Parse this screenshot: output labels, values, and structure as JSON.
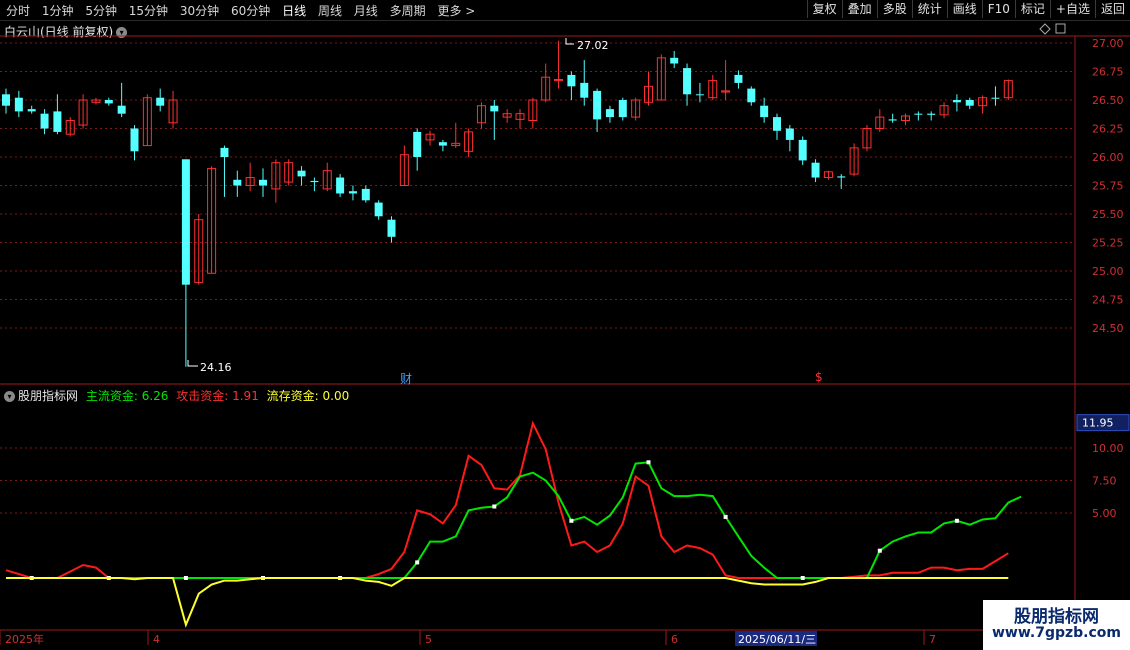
{
  "toolbar": {
    "periods": [
      "分时",
      "1分钟",
      "5分钟",
      "15分钟",
      "30分钟",
      "60分钟",
      "日线",
      "周线",
      "月线",
      "多周期",
      "更多 >"
    ],
    "active_period": "日线",
    "tools": [
      "复权",
      "叠加",
      "多股",
      "统计",
      "画线",
      "F10",
      "标记",
      "+自选",
      "返回"
    ]
  },
  "stock": {
    "title": "白云山(日线 前复权)",
    "high_label": "27.02",
    "low_label": "24.16",
    "marker_fin": "财",
    "marker_dollar": "$"
  },
  "price_axis": [
    "27.00",
    "26.75",
    "26.50",
    "26.25",
    "26.00",
    "25.75",
    "25.50",
    "25.25",
    "25.00",
    "24.75",
    "24.50"
  ],
  "indicator": {
    "name": "股朋指标网",
    "line1": "主流资金: 6.26",
    "line2": "攻击资金: 1.91",
    "line3": "流存资金: 0.00",
    "axis": [
      "11.95",
      "10.00",
      "7.50",
      "5.00"
    ],
    "current_value": "11.95"
  },
  "date_axis": {
    "labels": [
      "2025年",
      "4",
      "5",
      "6",
      "7"
    ],
    "cursor_date": "2025/06/11/三"
  },
  "colors": {
    "up": "#ff3030",
    "down": "#54ffff",
    "main_line": "#00e600",
    "attack_line": "#ff1a1a",
    "stock_line": "#ffff30",
    "grid": "#7a1a1a",
    "axis_text": "#d03030"
  },
  "chart_data": {
    "type": "candlestick",
    "price_ylim": [
      24.16,
      27.02
    ],
    "candles": [
      {
        "o": 26.45,
        "c": 26.55,
        "h": 26.6,
        "l": 26.38,
        "up": false
      },
      {
        "o": 26.52,
        "c": 26.4,
        "h": 26.58,
        "l": 26.35,
        "up": false
      },
      {
        "o": 26.42,
        "c": 26.4,
        "h": 26.45,
        "l": 26.38,
        "up": false
      },
      {
        "o": 26.38,
        "c": 26.25,
        "h": 26.42,
        "l": 26.2,
        "up": false
      },
      {
        "o": 26.4,
        "c": 26.22,
        "h": 26.55,
        "l": 26.2,
        "up": false
      },
      {
        "o": 26.2,
        "c": 26.32,
        "h": 26.35,
        "l": 26.18,
        "up": true
      },
      {
        "o": 26.28,
        "c": 26.5,
        "h": 26.55,
        "l": 26.25,
        "up": true
      },
      {
        "o": 26.48,
        "c": 26.5,
        "h": 26.52,
        "l": 26.46,
        "up": true
      },
      {
        "o": 26.5,
        "c": 26.47,
        "h": 26.52,
        "l": 26.45,
        "up": false
      },
      {
        "o": 26.45,
        "c": 26.38,
        "h": 26.65,
        "l": 26.35,
        "up": false
      },
      {
        "o": 26.25,
        "c": 26.05,
        "h": 26.28,
        "l": 25.97,
        "up": false
      },
      {
        "o": 26.1,
        "c": 26.52,
        "h": 26.55,
        "l": 26.1,
        "up": true
      },
      {
        "o": 26.52,
        "c": 26.45,
        "h": 26.6,
        "l": 26.4,
        "up": false
      },
      {
        "o": 26.3,
        "c": 26.5,
        "h": 26.58,
        "l": 26.25,
        "up": true
      },
      {
        "o": 25.98,
        "c": 24.88,
        "h": 25.98,
        "l": 24.16,
        "up": false
      },
      {
        "o": 24.9,
        "c": 25.45,
        "h": 25.5,
        "l": 24.88,
        "up": true
      },
      {
        "o": 24.98,
        "c": 25.9,
        "h": 25.92,
        "l": 24.98,
        "up": true
      },
      {
        "o": 26.08,
        "c": 26.0,
        "h": 26.1,
        "l": 25.65,
        "up": false
      },
      {
        "o": 25.8,
        "c": 25.75,
        "h": 25.88,
        "l": 25.65,
        "up": false
      },
      {
        "o": 25.75,
        "c": 25.82,
        "h": 25.95,
        "l": 25.7,
        "up": true
      },
      {
        "o": 25.8,
        "c": 25.75,
        "h": 25.9,
        "l": 25.65,
        "up": false
      },
      {
        "o": 25.72,
        "c": 25.95,
        "h": 25.98,
        "l": 25.6,
        "up": true
      },
      {
        "o": 25.78,
        "c": 25.95,
        "h": 25.98,
        "l": 25.75,
        "up": true
      },
      {
        "o": 25.88,
        "c": 25.83,
        "h": 25.92,
        "l": 25.75,
        "up": false
      },
      {
        "o": 25.79,
        "c": 25.78,
        "h": 25.82,
        "l": 25.7,
        "up": false
      },
      {
        "o": 25.72,
        "c": 25.88,
        "h": 25.95,
        "l": 25.7,
        "up": true
      },
      {
        "o": 25.82,
        "c": 25.68,
        "h": 25.85,
        "l": 25.65,
        "up": false
      },
      {
        "o": 25.7,
        "c": 25.68,
        "h": 25.75,
        "l": 25.62,
        "up": false
      },
      {
        "o": 25.72,
        "c": 25.62,
        "h": 25.75,
        "l": 25.6,
        "up": false
      },
      {
        "o": 25.6,
        "c": 25.48,
        "h": 25.62,
        "l": 25.45,
        "up": false
      },
      {
        "o": 25.45,
        "c": 25.3,
        "h": 25.48,
        "l": 25.25,
        "up": false
      },
      {
        "o": 25.75,
        "c": 26.02,
        "h": 26.1,
        "l": 25.75,
        "up": true
      },
      {
        "o": 26.22,
        "c": 26.0,
        "h": 26.25,
        "l": 25.88,
        "up": false
      },
      {
        "o": 26.15,
        "c": 26.2,
        "h": 26.23,
        "l": 26.1,
        "up": true
      },
      {
        "o": 26.13,
        "c": 26.1,
        "h": 26.15,
        "l": 26.05,
        "up": false
      },
      {
        "o": 26.1,
        "c": 26.12,
        "h": 26.3,
        "l": 26.08,
        "up": true
      },
      {
        "o": 26.05,
        "c": 26.22,
        "h": 26.25,
        "l": 26.0,
        "up": true
      },
      {
        "o": 26.3,
        "c": 26.45,
        "h": 26.48,
        "l": 26.25,
        "up": true
      },
      {
        "o": 26.45,
        "c": 26.4,
        "h": 26.5,
        "l": 26.15,
        "up": false
      },
      {
        "o": 26.35,
        "c": 26.38,
        "h": 26.42,
        "l": 26.3,
        "up": true
      },
      {
        "o": 26.33,
        "c": 26.38,
        "h": 26.42,
        "l": 26.25,
        "up": true
      },
      {
        "o": 26.32,
        "c": 26.5,
        "h": 26.52,
        "l": 26.25,
        "up": true
      },
      {
        "o": 26.5,
        "c": 26.7,
        "h": 26.82,
        "l": 26.48,
        "up": true
      },
      {
        "o": 26.67,
        "c": 26.68,
        "h": 27.02,
        "l": 26.6,
        "up": true
      },
      {
        "o": 26.72,
        "c": 26.62,
        "h": 26.75,
        "l": 26.5,
        "up": false
      },
      {
        "o": 26.65,
        "c": 26.52,
        "h": 26.85,
        "l": 26.45,
        "up": false
      },
      {
        "o": 26.58,
        "c": 26.33,
        "h": 26.6,
        "l": 26.22,
        "up": false
      },
      {
        "o": 26.42,
        "c": 26.35,
        "h": 26.45,
        "l": 26.3,
        "up": false
      },
      {
        "o": 26.5,
        "c": 26.35,
        "h": 26.52,
        "l": 26.32,
        "up": false
      },
      {
        "o": 26.35,
        "c": 26.5,
        "h": 26.52,
        "l": 26.32,
        "up": true
      },
      {
        "o": 26.48,
        "c": 26.62,
        "h": 26.75,
        "l": 26.45,
        "up": true
      },
      {
        "o": 26.5,
        "c": 26.87,
        "h": 26.9,
        "l": 26.5,
        "up": true
      },
      {
        "o": 26.87,
        "c": 26.82,
        "h": 26.93,
        "l": 26.78,
        "up": false
      },
      {
        "o": 26.78,
        "c": 26.55,
        "h": 26.82,
        "l": 26.45,
        "up": false
      },
      {
        "o": 26.55,
        "c": 26.55,
        "h": 26.65,
        "l": 26.48,
        "up": false
      },
      {
        "o": 26.52,
        "c": 26.67,
        "h": 26.72,
        "l": 26.5,
        "up": true
      },
      {
        "o": 26.57,
        "c": 26.58,
        "h": 26.85,
        "l": 26.5,
        "up": true
      },
      {
        "o": 26.72,
        "c": 26.65,
        "h": 26.76,
        "l": 26.6,
        "up": false
      },
      {
        "o": 26.6,
        "c": 26.48,
        "h": 26.62,
        "l": 26.45,
        "up": false
      },
      {
        "o": 26.45,
        "c": 26.35,
        "h": 26.52,
        "l": 26.3,
        "up": false
      },
      {
        "o": 26.35,
        "c": 26.23,
        "h": 26.38,
        "l": 26.15,
        "up": false
      },
      {
        "o": 26.25,
        "c": 26.15,
        "h": 26.28,
        "l": 26.05,
        "up": false
      },
      {
        "o": 26.15,
        "c": 25.97,
        "h": 26.18,
        "l": 25.93,
        "up": false
      },
      {
        "o": 25.95,
        "c": 25.82,
        "h": 25.98,
        "l": 25.78,
        "up": false
      },
      {
        "o": 25.82,
        "c": 25.87,
        "h": 25.88,
        "l": 25.8,
        "up": true
      },
      {
        "o": 25.83,
        "c": 25.82,
        "h": 25.85,
        "l": 25.72,
        "up": false
      },
      {
        "o": 25.85,
        "c": 26.08,
        "h": 26.12,
        "l": 25.83,
        "up": true
      },
      {
        "o": 26.08,
        "c": 26.25,
        "h": 26.28,
        "l": 26.05,
        "up": true
      },
      {
        "o": 26.25,
        "c": 26.35,
        "h": 26.42,
        "l": 26.22,
        "up": true
      },
      {
        "o": 26.33,
        "c": 26.32,
        "h": 26.38,
        "l": 26.3,
        "up": false
      },
      {
        "o": 26.32,
        "c": 26.36,
        "h": 26.38,
        "l": 26.28,
        "up": true
      },
      {
        "o": 26.38,
        "c": 26.38,
        "h": 26.4,
        "l": 26.32,
        "up": false
      },
      {
        "o": 26.38,
        "c": 26.37,
        "h": 26.4,
        "l": 26.32,
        "up": false
      },
      {
        "o": 26.37,
        "c": 26.45,
        "h": 26.48,
        "l": 26.34,
        "up": true
      },
      {
        "o": 26.5,
        "c": 26.48,
        "h": 26.55,
        "l": 26.4,
        "up": false
      },
      {
        "o": 26.5,
        "c": 26.45,
        "h": 26.52,
        "l": 26.42,
        "up": false
      },
      {
        "o": 26.45,
        "c": 26.52,
        "h": 26.54,
        "l": 26.38,
        "up": true
      },
      {
        "o": 26.52,
        "c": 26.52,
        "h": 26.62,
        "l": 26.45,
        "up": false
      },
      {
        "o": 26.52,
        "c": 26.67,
        "h": 26.68,
        "l": 26.5,
        "up": true
      }
    ],
    "indicator_ylim": [
      -2.5,
      12.5
    ],
    "series": [
      {
        "name": "主流资金",
        "values": [
          0,
          0,
          0,
          0,
          0,
          0,
          0,
          0,
          0,
          0,
          0,
          0,
          0,
          0,
          0,
          0,
          0,
          0,
          0,
          0,
          0,
          0,
          0,
          0,
          0,
          0,
          0,
          0,
          0,
          0,
          0,
          0,
          1.2,
          2.8,
          2.8,
          3.2,
          5.2,
          5.4,
          5.5,
          6.2,
          7.8,
          8.1,
          7.5,
          6.3,
          4.4,
          4.7,
          4.1,
          4.8,
          6.2,
          8.8,
          8.9,
          6.9,
          6.3,
          6.3,
          6.4,
          6.3,
          4.7,
          3.2,
          1.7,
          0.8,
          0,
          0,
          0,
          0,
          0,
          0,
          0,
          0,
          2.1,
          2.8,
          3.2,
          3.5,
          3.5,
          4.2,
          4.4,
          4.1,
          4.5,
          4.6,
          5.8,
          6.26
        ]
      },
      {
        "name": "攻击资金",
        "values": [
          0.6,
          0.3,
          0,
          0,
          0,
          0.5,
          1.0,
          0.8,
          0,
          0,
          0,
          0,
          0,
          0,
          0,
          0,
          0,
          0,
          0,
          0,
          0,
          0,
          0,
          0,
          0,
          0,
          0,
          0,
          0,
          0.3,
          0.7,
          2.0,
          5.2,
          4.9,
          4.2,
          5.6,
          9.4,
          8.7,
          6.9,
          6.8,
          7.9,
          11.9,
          9.9,
          5.8,
          2.5,
          2.8,
          2.0,
          2.5,
          4.2,
          7.8,
          7.1,
          3.2,
          2.0,
          2.5,
          2.3,
          1.8,
          0.2,
          0,
          0,
          0,
          0,
          0,
          0,
          0,
          0,
          0,
          0.1,
          0.2,
          0.2,
          0.4,
          0.4,
          0.4,
          0.8,
          0.8,
          0.6,
          0.7,
          0.7,
          1.3,
          1.91
        ]
      },
      {
        "name": "流存资金",
        "values": [
          0,
          0,
          0,
          0,
          0,
          0,
          0,
          0,
          0,
          0,
          -0.1,
          0,
          0,
          0,
          -3.6,
          -1.2,
          -0.5,
          -0.2,
          -0.2,
          -0.1,
          0,
          0,
          0,
          0,
          0,
          0,
          0,
          0,
          -0.2,
          -0.3,
          -0.6,
          0,
          0,
          0,
          0,
          0,
          0,
          0,
          0,
          0,
          0,
          0,
          0,
          0,
          0,
          0,
          0,
          0,
          0,
          0,
          0,
          0,
          0,
          0,
          0,
          0,
          0,
          -0.2,
          -0.4,
          -0.5,
          -0.5,
          -0.5,
          -0.5,
          -0.3,
          0,
          0,
          0,
          0,
          0,
          0,
          0,
          0,
          0,
          0,
          0,
          0,
          0,
          0,
          0.0
        ]
      }
    ]
  }
}
